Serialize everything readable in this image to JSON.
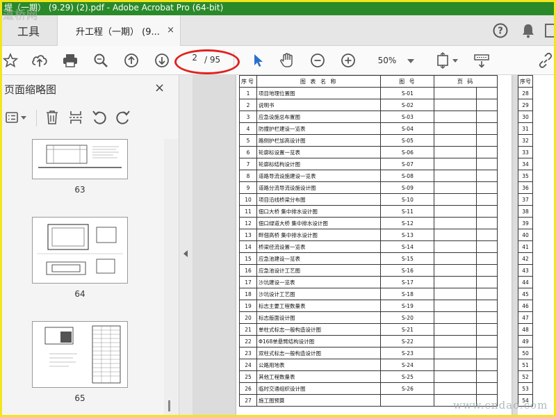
{
  "window": {
    "title": "堤（一期） (9.29) (2).pdf - Adobe Acrobat Pro (64-bit)"
  },
  "tabs": {
    "tools": "工具",
    "document": "升工程（一期） (9...",
    "document_close": "×"
  },
  "toolbar": {
    "page_current": "2",
    "page_total": "/ 95",
    "zoom": "50%"
  },
  "left_panel": {
    "title": "页面缩略图",
    "close": "×",
    "thumbnails": [
      "63",
      "64",
      "65"
    ]
  },
  "toc": {
    "headers": [
      "序号",
      "图 表 名 称",
      "图 号",
      "页 码"
    ],
    "rows": [
      {
        "no": "1",
        "name": "项目地理位置图",
        "code": "S-01"
      },
      {
        "no": "2",
        "name": "说明书",
        "code": "S-02"
      },
      {
        "no": "3",
        "name": "应急设施总布置图",
        "code": "S-03"
      },
      {
        "no": "4",
        "name": "防撞护栏建设一览表",
        "code": "S-04"
      },
      {
        "no": "5",
        "name": "路侧护栏加高设计图",
        "code": "S-05"
      },
      {
        "no": "6",
        "name": "轮廓标设置一览表",
        "code": "S-06"
      },
      {
        "no": "7",
        "name": "轮廓标结构设计图",
        "code": "S-07"
      },
      {
        "no": "8",
        "name": "道路导流设施建设一览表",
        "code": "S-08"
      },
      {
        "no": "9",
        "name": "道路分流导流设施设计图",
        "code": "S-09"
      },
      {
        "no": "10",
        "name": "项目沿线桥梁分布图",
        "code": "S-10"
      },
      {
        "no": "11",
        "name": "佃口大桥  集中排水设计图",
        "code": "S-11"
      },
      {
        "no": "12",
        "name": "佃口绿道大桥  集中排水设计图",
        "code": "S-12"
      },
      {
        "no": "13",
        "name": "畔佃高桥  集中排水设计图",
        "code": "S-13"
      },
      {
        "no": "14",
        "name": "桥梁径流设置一览表",
        "code": "S-14"
      },
      {
        "no": "15",
        "name": "应急池建设一览表",
        "code": "S-15"
      },
      {
        "no": "16",
        "name": "应急池设计工艺图",
        "code": "S-16"
      },
      {
        "no": "17",
        "name": "沙坑建设一览表",
        "code": "S-17"
      },
      {
        "no": "18",
        "name": "沙坑设计工艺图",
        "code": "S-18"
      },
      {
        "no": "19",
        "name": "标志主要工程数量表",
        "code": "S-19"
      },
      {
        "no": "20",
        "name": "标志版面设计图",
        "code": "S-20"
      },
      {
        "no": "21",
        "name": "单柱式标志一般构造设计图",
        "code": "S-21"
      },
      {
        "no": "22",
        "name": "Φ168单悬臂结构设计图",
        "code": "S-22"
      },
      {
        "no": "23",
        "name": "双柱式标志一般构造设计图",
        "code": "S-23"
      },
      {
        "no": "24",
        "name": "公路用地表",
        "code": "S-24"
      },
      {
        "no": "25",
        "name": "其他工程数量表",
        "code": "S-25"
      },
      {
        "no": "26",
        "name": "临时交通组织设计图",
        "code": "S-26"
      },
      {
        "no": "27",
        "name": "施工图预算",
        "code": ""
      }
    ],
    "second_header": "序号",
    "second_numbers": [
      "28",
      "29",
      "30",
      "31",
      "32",
      "33",
      "34",
      "35",
      "36",
      "37",
      "38",
      "39",
      "40",
      "41",
      "42",
      "43",
      "44",
      "45",
      "46",
      "47",
      "48",
      "49",
      "50",
      "51",
      "52",
      "53",
      "54"
    ]
  },
  "watermarks": {
    "top": "道桥网",
    "bottom": "www.cndao.com"
  }
}
